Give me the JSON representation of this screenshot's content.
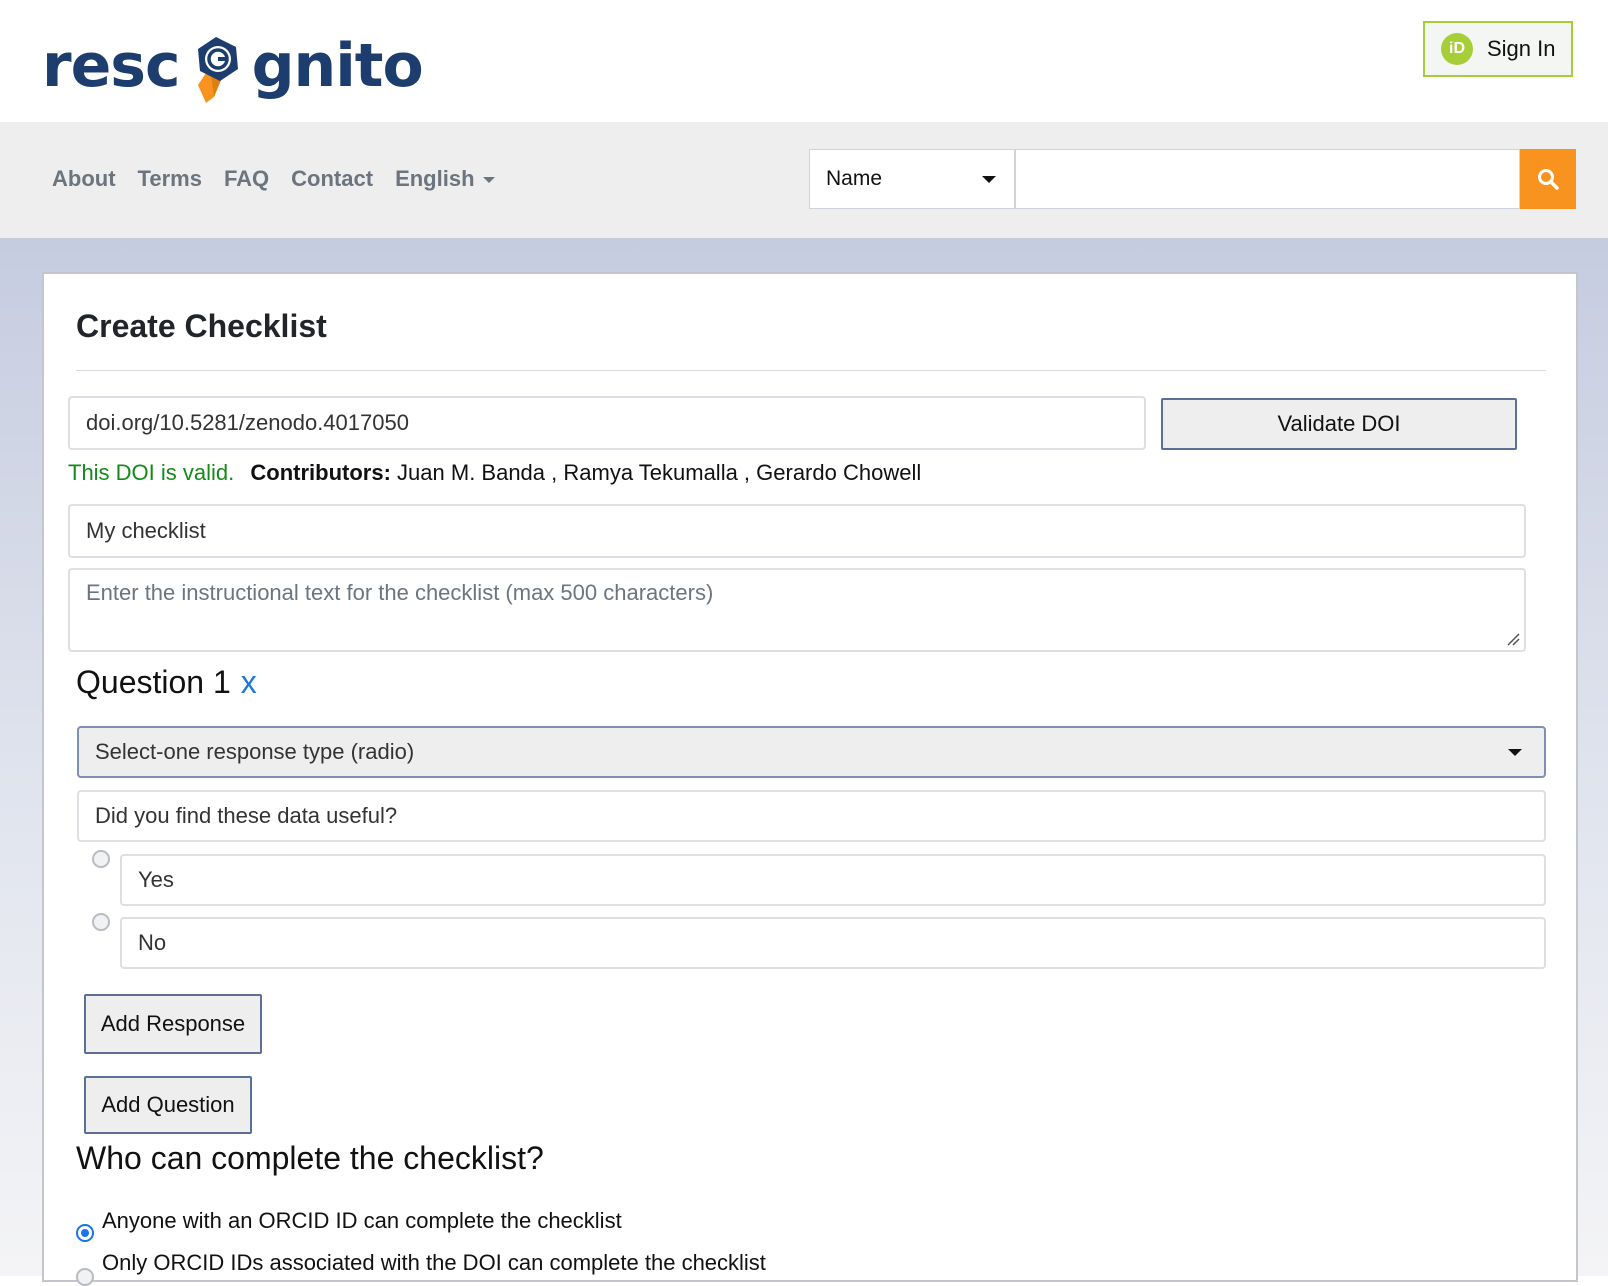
{
  "header": {
    "logo_part1": "resc",
    "logo_part2": "gnito",
    "signin_icon": "iD",
    "signin_label": "Sign In"
  },
  "nav": {
    "links": [
      "About",
      "Terms",
      "FAQ",
      "Contact",
      "English"
    ],
    "search_type": "Name",
    "search_value": ""
  },
  "form": {
    "title": "Create Checklist",
    "doi_value": "doi.org/10.5281/zenodo.4017050",
    "validate_label": "Validate DOI",
    "valid_text": "This DOI is valid.",
    "contributors_label": "Contributors:",
    "contributors": "Juan M. Banda , Ramya Tekumalla , Gerardo Chowell",
    "checklist_name": "My checklist",
    "instructions_placeholder": "Enter the instructional text for the checklist (max 500 characters)",
    "question": {
      "label": "Question 1",
      "remove": "x",
      "response_type": "Select-one response type (radio)",
      "text": "Did you find these data useful?",
      "responses": [
        "Yes",
        "No"
      ]
    },
    "add_response_label": "Add Response",
    "add_question_label": "Add Question",
    "who_title": "Who can complete the checklist?",
    "who_options": [
      "Anyone with an ORCID ID can complete the checklist",
      "Only ORCID IDs associated with the DOI can complete the checklist"
    ]
  },
  "colors": {
    "brand_navy": "#1c3d6e",
    "brand_orange": "#f7931e",
    "orcid_green": "#a6ce39",
    "valid_green": "#158a18",
    "link_blue": "#1e78d6"
  }
}
